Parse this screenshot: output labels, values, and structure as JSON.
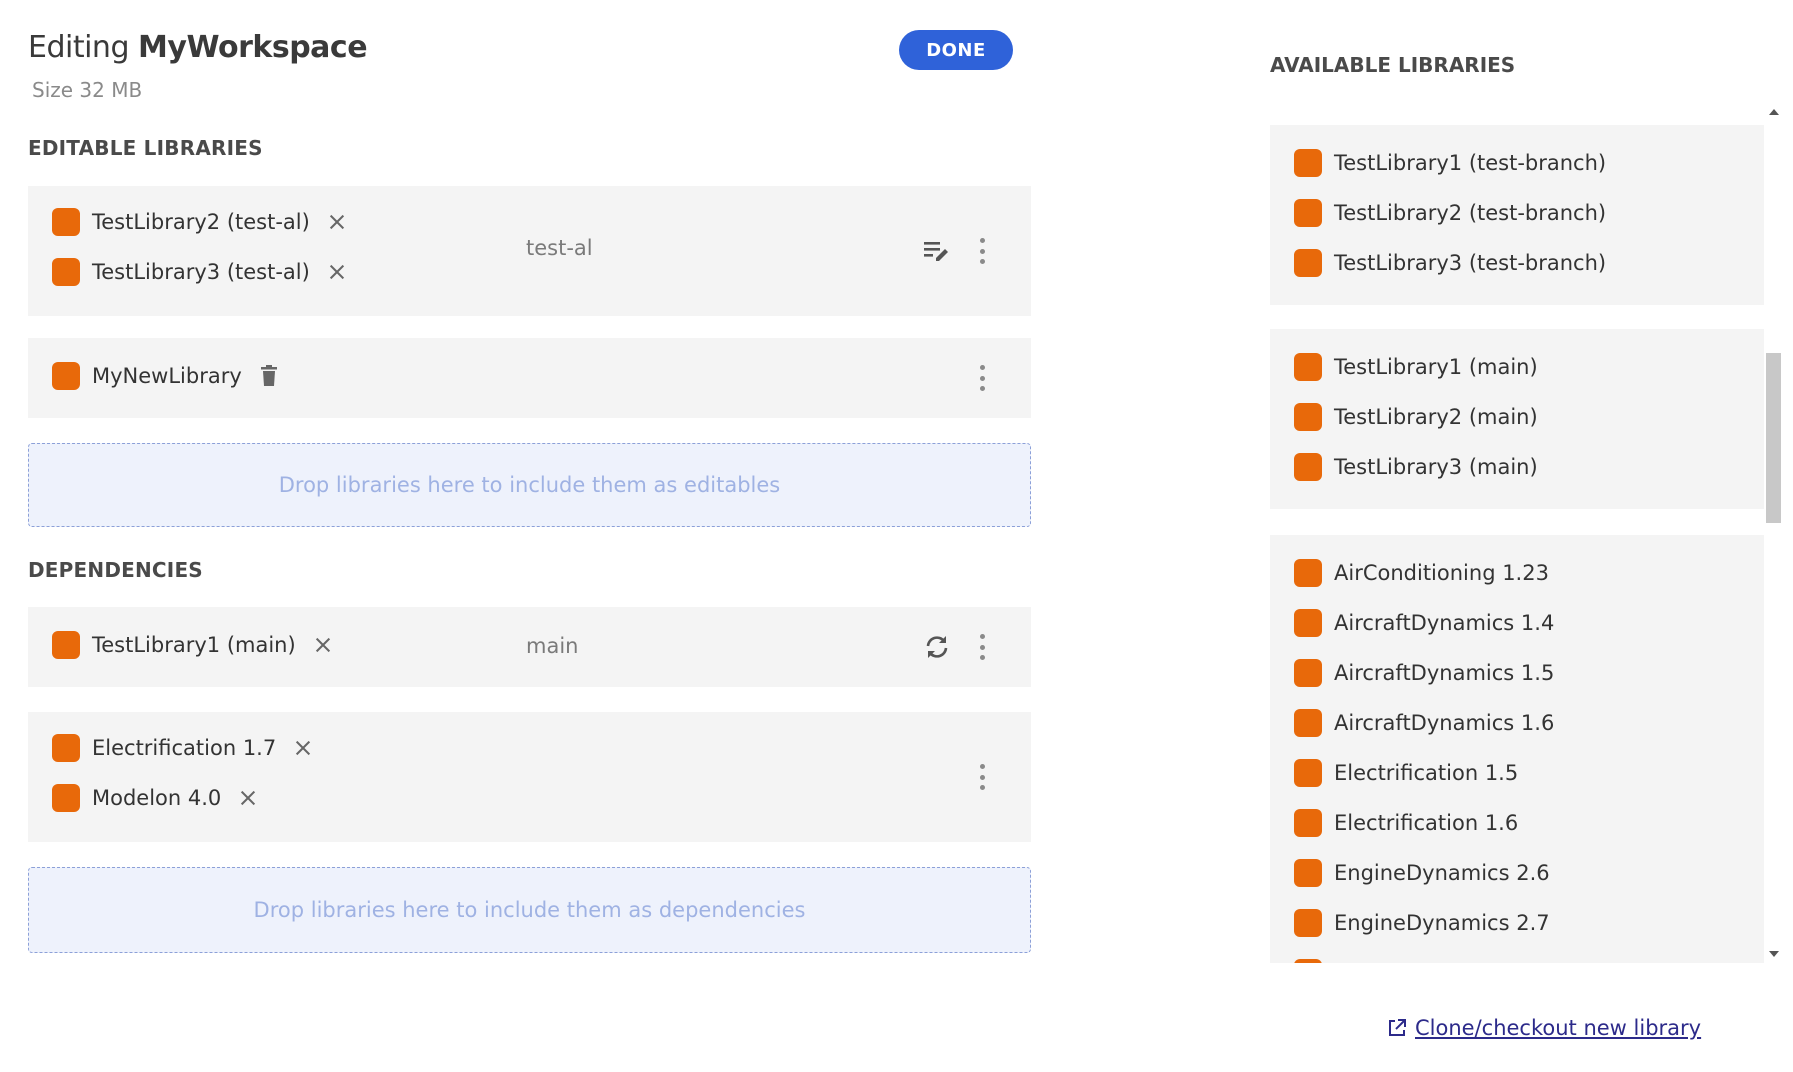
{
  "header": {
    "title_prefix": "Editing",
    "workspace_name": "MyWorkspace",
    "size_text": "Size 32 MB",
    "done_label": "DONE"
  },
  "editable": {
    "section_title": "EDITABLE LIBRARIES",
    "group1": {
      "libraries": [
        "TestLibrary2 (test-al)",
        "TestLibrary3 (test-al)"
      ],
      "branch": "test-al",
      "action_icon": "edit-list-icon"
    },
    "group2": {
      "libraries": [
        "MyNewLibrary"
      ],
      "action_icon": "trash-icon"
    },
    "dropzone_text": "Drop libraries here to include them as editables"
  },
  "dependencies": {
    "section_title": "DEPENDENCIES",
    "group1": {
      "libraries": [
        "TestLibrary1 (main)"
      ],
      "branch": "main",
      "action_icon": "sync-icon"
    },
    "group2": {
      "libraries": [
        "Electrification 1.7",
        "Modelon 4.0"
      ]
    },
    "dropzone_text": "Drop libraries here to include them as dependencies"
  },
  "available": {
    "section_title": "AVAILABLE LIBRARIES",
    "groups": [
      [
        "TestLibrary1 (test-branch)",
        "TestLibrary2 (test-branch)",
        "TestLibrary3 (test-branch)"
      ],
      [
        "TestLibrary1 (main)",
        "TestLibrary2 (main)",
        "TestLibrary3 (main)"
      ],
      [
        "AirConditioning 1.23",
        "AircraftDynamics 1.4",
        "AircraftDynamics 1.5",
        "AircraftDynamics 1.6",
        "Electrification 1.5",
        "Electrification 1.6",
        "EngineDynamics 2.6",
        "EngineDynamics 2.7"
      ]
    ]
  },
  "footer": {
    "clone_link": "Clone/checkout new library"
  },
  "colors": {
    "accent": "#2f62d9",
    "library_swatch": "#e8690a",
    "card_bg": "#f4f4f4",
    "dropzone_bg": "#eef2fc",
    "link": "#2c2a8a"
  }
}
